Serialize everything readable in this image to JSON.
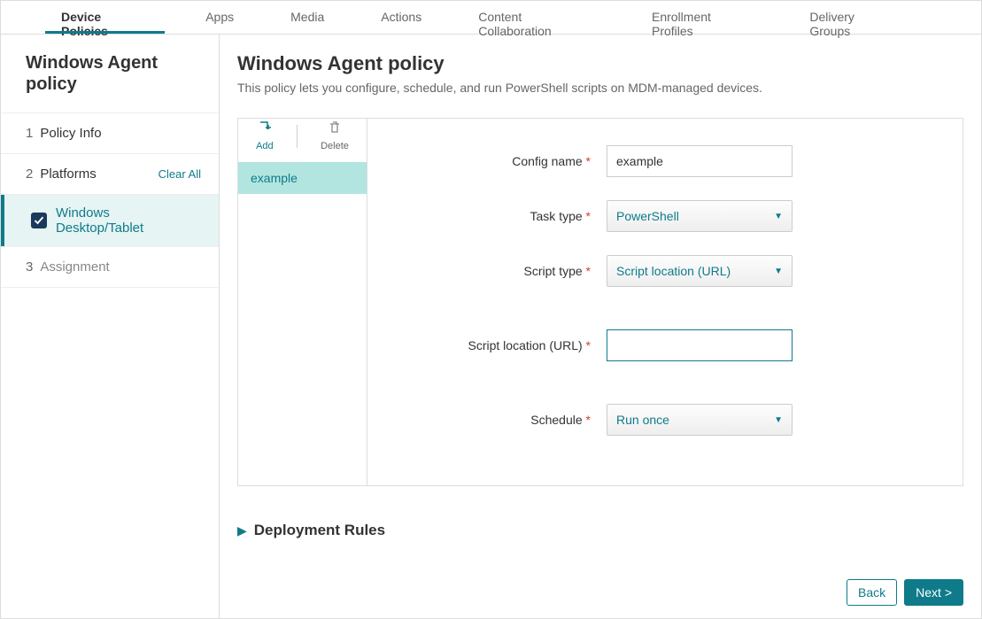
{
  "top_tabs": {
    "device_policies": "Device Policies",
    "apps": "Apps",
    "media": "Media",
    "actions": "Actions",
    "content_collab": "Content Collaboration",
    "enrollment": "Enrollment Profiles",
    "delivery": "Delivery Groups"
  },
  "sidebar": {
    "title": "Windows Agent policy",
    "step1_num": "1",
    "step1_label": "Policy Info",
    "step2_num": "2",
    "step2_label": "Platforms",
    "clear_all": "Clear All",
    "platform1": "Windows Desktop/Tablet",
    "step3_num": "3",
    "step3_label": "Assignment"
  },
  "main": {
    "title": "Windows Agent policy",
    "desc": "This policy lets you configure, schedule, and run PowerShell scripts on MDM-managed devices."
  },
  "toolbar": {
    "add": "Add",
    "delete": "Delete"
  },
  "config_list": {
    "item0": "example"
  },
  "form": {
    "config_name_label": "Config name",
    "config_name_value": "example",
    "task_type_label": "Task type",
    "task_type_value": "PowerShell",
    "script_type_label": "Script type",
    "script_type_value": "Script location (URL)",
    "script_loc_label": "Script location (URL)",
    "script_loc_value": "",
    "schedule_label": "Schedule",
    "schedule_value": "Run once",
    "required": "*"
  },
  "deployment_rules": "Deployment Rules",
  "buttons": {
    "back": "Back",
    "next": "Next >"
  }
}
